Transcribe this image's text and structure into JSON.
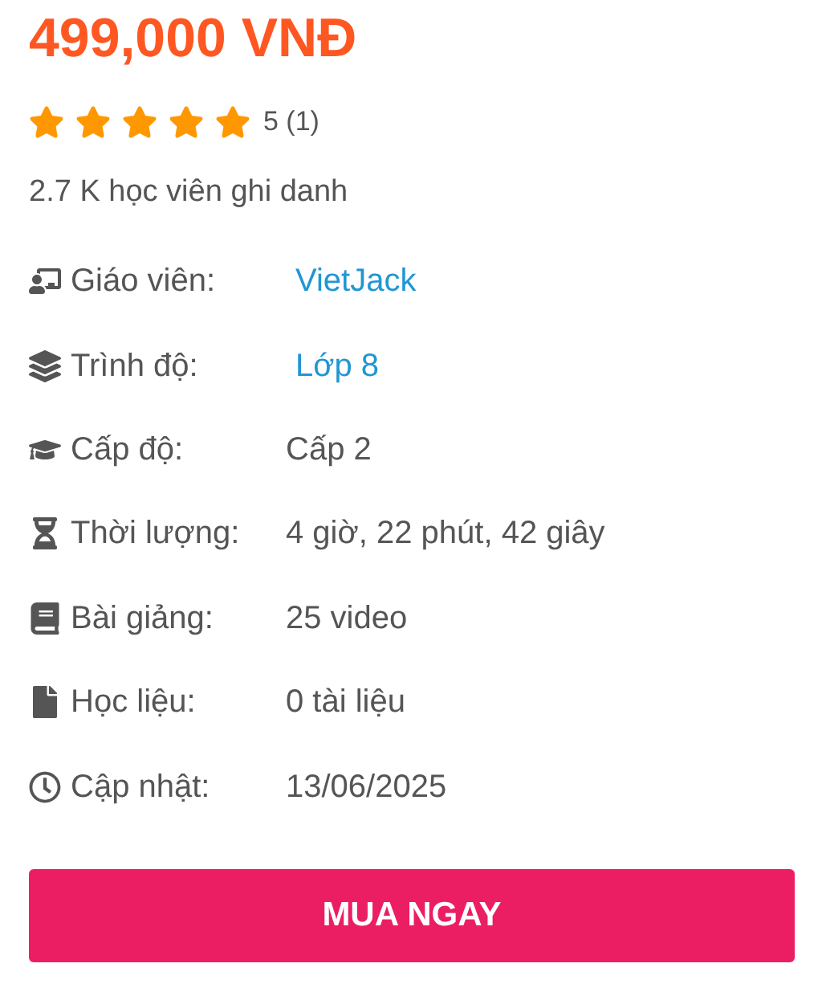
{
  "price": "499,000 VNĐ",
  "rating": {
    "stars": 5,
    "score": "5 (1)"
  },
  "enrolled": "2.7 K học viên ghi danh",
  "details": [
    {
      "label": "Giáo viên:",
      "value": "VietJack",
      "kind": "link"
    },
    {
      "label": "Trình độ:",
      "value": "Lớp 8",
      "kind": "link"
    },
    {
      "label": "Cấp độ:",
      "value": "Cấp 2",
      "kind": "text"
    },
    {
      "label": "Thời lượng:",
      "value": "4 giờ, 22 phút, 42 giây",
      "kind": "text"
    },
    {
      "label": "Bài giảng:",
      "value": "25 video",
      "kind": "text"
    },
    {
      "label": "Học liệu:",
      "value": "0 tài liệu",
      "kind": "text"
    },
    {
      "label": "Cập nhật:",
      "value": "13/06/2025",
      "kind": "text"
    }
  ],
  "buy_button": "MUA NGAY"
}
